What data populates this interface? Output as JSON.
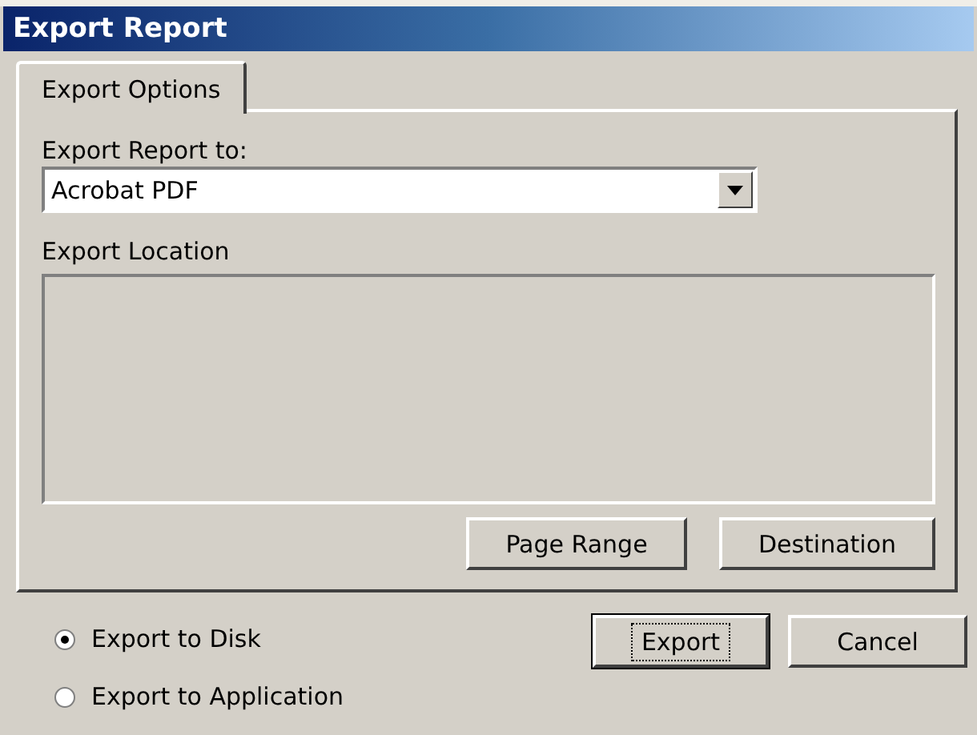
{
  "window": {
    "title": "Export Report"
  },
  "tabs": [
    {
      "label": "Export Options",
      "selected": true
    }
  ],
  "export_to": {
    "label": "Export Report to:",
    "value": "Acrobat PDF"
  },
  "export_location": {
    "label": "Export Location"
  },
  "panel_buttons": [
    {
      "label": "Page Range",
      "default": false
    },
    {
      "label": "Destination",
      "default": false
    }
  ],
  "radios": [
    {
      "label": "Export to Disk",
      "selected": true
    },
    {
      "label": "Export to Application",
      "selected": false
    }
  ],
  "buttons": [
    {
      "label": "Export",
      "default": true
    },
    {
      "label": "Cancel",
      "default": false
    }
  ]
}
